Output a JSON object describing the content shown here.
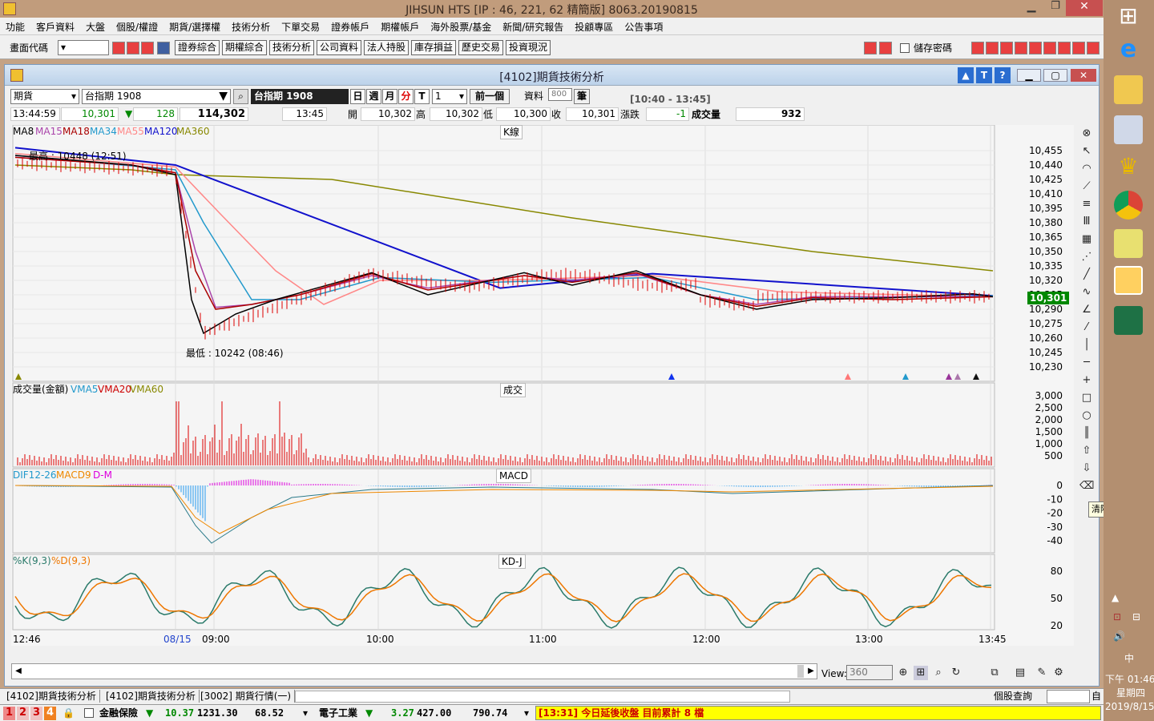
{
  "app": {
    "title": "JIHSUN HTS      [IP : 46, 221, 62 精簡版] 8063.20190815"
  },
  "menu": [
    "功能",
    "客戶資料",
    "大盤",
    "個股/權證",
    "期貨/選擇權",
    "技術分析",
    "下單交易",
    "證券帳戶",
    "期權帳戶",
    "海外股票/基金",
    "新聞/研究報告",
    "投顧專區",
    "公告事項"
  ],
  "toolbar": {
    "code_label": "畫面代碼",
    "buttons": [
      "證券綜合",
      "期權綜合",
      "技術分析",
      "公司資料",
      "法人持股",
      "庫存損益",
      "歷史交易",
      "投資現況"
    ],
    "save_pwd": "儲存密碼"
  },
  "window": {
    "title": "[4102]期貨技術分析"
  },
  "controls": {
    "type": "期貨",
    "symbol": "台指期 1908",
    "symbol_name": "台指期 1908",
    "periods": [
      "日",
      "週",
      "月",
      "分",
      "T"
    ],
    "period_value": "1",
    "prev_btn": "前一個",
    "data_label": "資料",
    "data_count": "800",
    "unit": "筆",
    "time_range": "[10:40 - 13:45]"
  },
  "quote": {
    "time": "13:44:59",
    "price": "10,301",
    "change": "128",
    "volume": "114,302",
    "qtime": "13:45",
    "open_label": "開",
    "open": "10,302",
    "high_label": "高",
    "high": "10,302",
    "low_label": "低",
    "low": "10,300",
    "close_label": "收",
    "close": "10,301",
    "chg_label": "漲跌",
    "chg": "-1",
    "vol_label": "成交量",
    "vol": "932"
  },
  "chart_data": [
    {
      "type": "line",
      "title": "K線",
      "legend": [
        "MA8",
        "MA15",
        "MA18",
        "MA34",
        "MA55",
        "MA120",
        "MA360"
      ],
      "colors": {
        "MA8": "#000000",
        "MA15": "#aa44aa",
        "MA18": "#aa0000",
        "MA34": "#2299cc",
        "MA55": "#ff8888",
        "MA120": "#1111cc",
        "MA360": "#888800"
      },
      "ylim": [
        10222,
        10463
      ],
      "yticks": [
        "10,455",
        "10,440",
        "10,425",
        "10,410",
        "10,395",
        "10,380",
        "10,365",
        "10,350",
        "10,335",
        "10,320",
        "10,305",
        "10,290",
        "10,275",
        "10,260",
        "10,245",
        "10,230"
      ],
      "last_price": "10,301",
      "high_note": "最高 : 10448 (12:51)",
      "low_note": "最低 : 10242 (08:46)",
      "xlabels": [
        "12:46",
        "08/15",
        "09:00",
        "10:00",
        "11:00",
        "12:00",
        "13:00",
        "13:45"
      ]
    },
    {
      "type": "bar",
      "title": "成交",
      "legend": [
        "成交量(金額)",
        "VMA5",
        "VMA20",
        "VMA60"
      ],
      "yticks": [
        "3,000",
        "2,500",
        "2,000",
        "1,500",
        "1,000",
        "500"
      ]
    },
    {
      "type": "bar",
      "title": "MACD",
      "legend": [
        "DIF12-26",
        "MACD9",
        "D-M"
      ],
      "yticks": [
        "0",
        "-10",
        "-20",
        "-30",
        "-40"
      ]
    },
    {
      "type": "line",
      "title": "KD-J",
      "legend": [
        "%K(9,3)",
        "%D(9,3)"
      ],
      "yticks": [
        "80",
        "50",
        "20"
      ]
    }
  ],
  "view": {
    "label": "View:",
    "value": "360"
  },
  "tooltip": "清除",
  "tabs": [
    "[4102]期貨技術分析",
    "[4102]期貨技術分析",
    "[3002] 期貨行情(一)"
  ],
  "status": {
    "query": "個股查詢",
    "num_btns": [
      "1",
      "2",
      "3",
      "4"
    ],
    "sector1": "金融保險",
    "s1_chg": "10.37",
    "s1_idx": "1231.30",
    "s1_vol": "68.52",
    "sector2": "電子工業",
    "s2_chg": "3.27",
    "s2_idx": "427.00",
    "s2_vol": "790.74",
    "ticker": "[13:31] 今日延後收盤 目前累計 8 檔"
  },
  "clock": {
    "time": "下午 01:46",
    "day": "星期四",
    "date": "2019/8/15",
    "ime": "中"
  },
  "colors": {
    "accent_red": "#e02020",
    "price_green": "#008800",
    "ticker_bg": "#ffff00"
  }
}
